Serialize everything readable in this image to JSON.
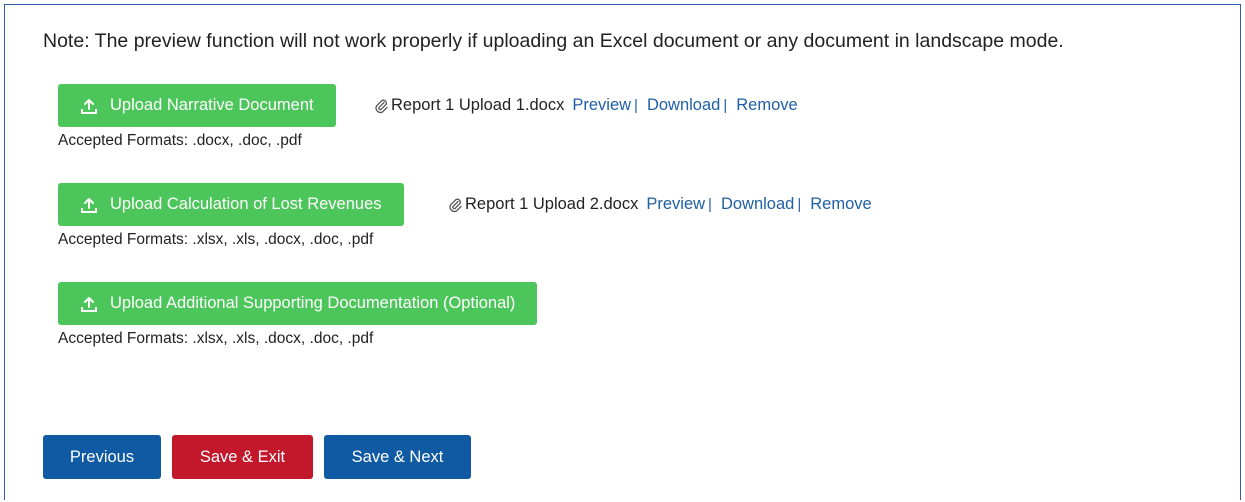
{
  "note": "Note: The preview function will not work properly if uploading an Excel document or any document in landscape mode.",
  "uploads": [
    {
      "label": "Upload Narrative Document",
      "formats": "Accepted Formats: .docx, .doc, .pdf",
      "file": {
        "name": "Report 1 Upload 1.docx",
        "preview": "Preview",
        "download": "Download",
        "remove": "Remove"
      }
    },
    {
      "label": "Upload Calculation of Lost Revenues",
      "formats": "Accepted Formats: .xlsx, .xls, .docx, .doc, .pdf",
      "file": {
        "name": "Report 1 Upload 2.docx",
        "preview": "Preview",
        "download": "Download",
        "remove": "Remove"
      }
    },
    {
      "label": "Upload Additional Supporting Documentation (Optional)",
      "formats": "Accepted Formats: .xlsx, .xls, .docx, .doc, .pdf"
    }
  ],
  "nav": {
    "previous": "Previous",
    "save_exit": "Save & Exit",
    "save_next": "Save & Next"
  },
  "colors": {
    "upload_green": "#4cc65a",
    "primary_blue": "#0f5aa2",
    "danger_red": "#c3182c",
    "link_blue": "#1f5fa6"
  }
}
